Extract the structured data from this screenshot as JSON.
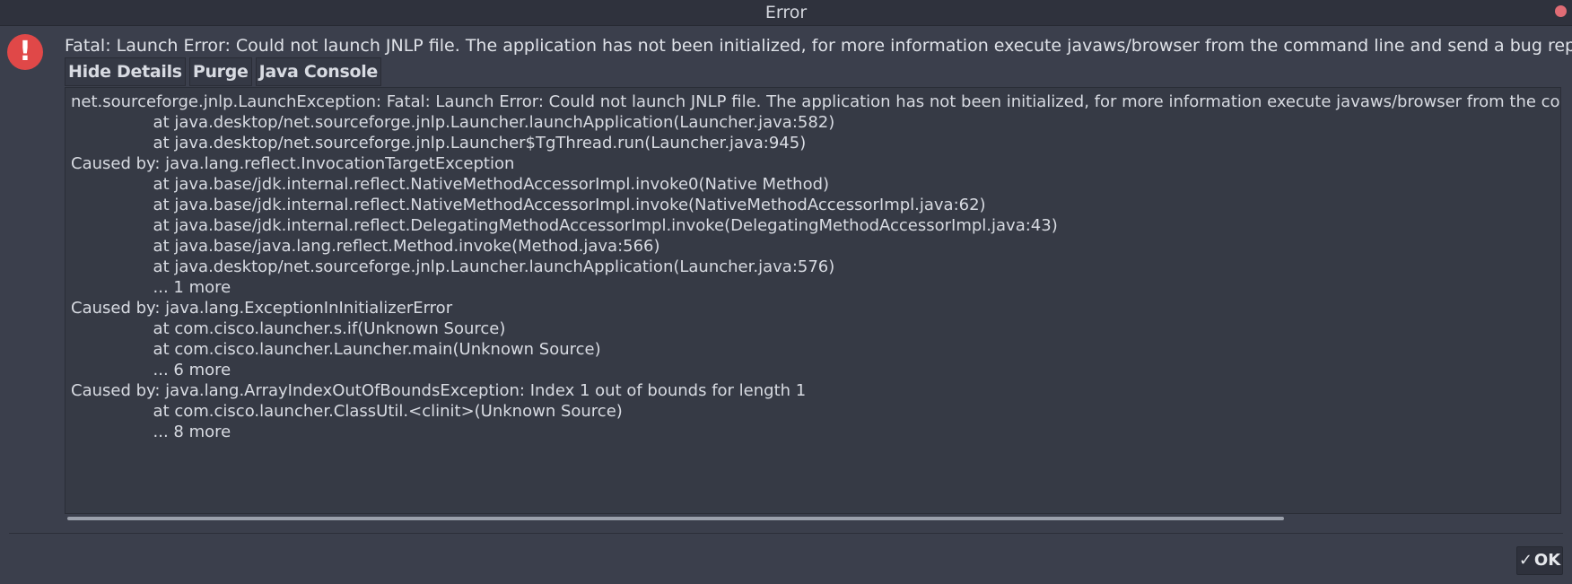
{
  "window": {
    "title": "Error"
  },
  "message": "Fatal: Launch Error: Could not launch JNLP file. The application has not been initialized, for more information execute javaws/browser from the command line and send a bug report.",
  "tabs": [
    {
      "label": "Hide Details"
    },
    {
      "label": "Purge"
    },
    {
      "label": "Java Console"
    }
  ],
  "details": {
    "text": "net.sourceforge.jnlp.LaunchException: Fatal: Launch Error: Could not launch JNLP file. The application has not been initialized, for more information execute javaws/browser from the command line and send a bug report.\n\t\tat java.desktop/net.sourceforge.jnlp.Launcher.launchApplication(Launcher.java:582)\n\t\tat java.desktop/net.sourceforge.jnlp.Launcher$TgThread.run(Launcher.java:945)\nCaused by: java.lang.reflect.InvocationTargetException\n\t\tat java.base/jdk.internal.reflect.NativeMethodAccessorImpl.invoke0(Native Method)\n\t\tat java.base/jdk.internal.reflect.NativeMethodAccessorImpl.invoke(NativeMethodAccessorImpl.java:62)\n\t\tat java.base/jdk.internal.reflect.DelegatingMethodAccessorImpl.invoke(DelegatingMethodAccessorImpl.java:43)\n\t\tat java.base/java.lang.reflect.Method.invoke(Method.java:566)\n\t\tat java.desktop/net.sourceforge.jnlp.Launcher.launchApplication(Launcher.java:576)\n\t\t... 1 more\nCaused by: java.lang.ExceptionInInitializerError\n\t\tat com.cisco.launcher.s.if(Unknown Source)\n\t\tat com.cisco.launcher.Launcher.main(Unknown Source)\n\t\t... 6 more\nCaused by: java.lang.ArrayIndexOutOfBoundsException: Index 1 out of bounds for length 1\n\t\tat com.cisco.launcher.ClassUtil.<clinit>(Unknown Source)\n\t\t... 8 more"
  },
  "ok_button": {
    "label": "OK",
    "icon": "check-icon"
  },
  "colors": {
    "background": "#3b3f4c",
    "error_icon": "#e04848",
    "close_button": "#e06c75"
  }
}
